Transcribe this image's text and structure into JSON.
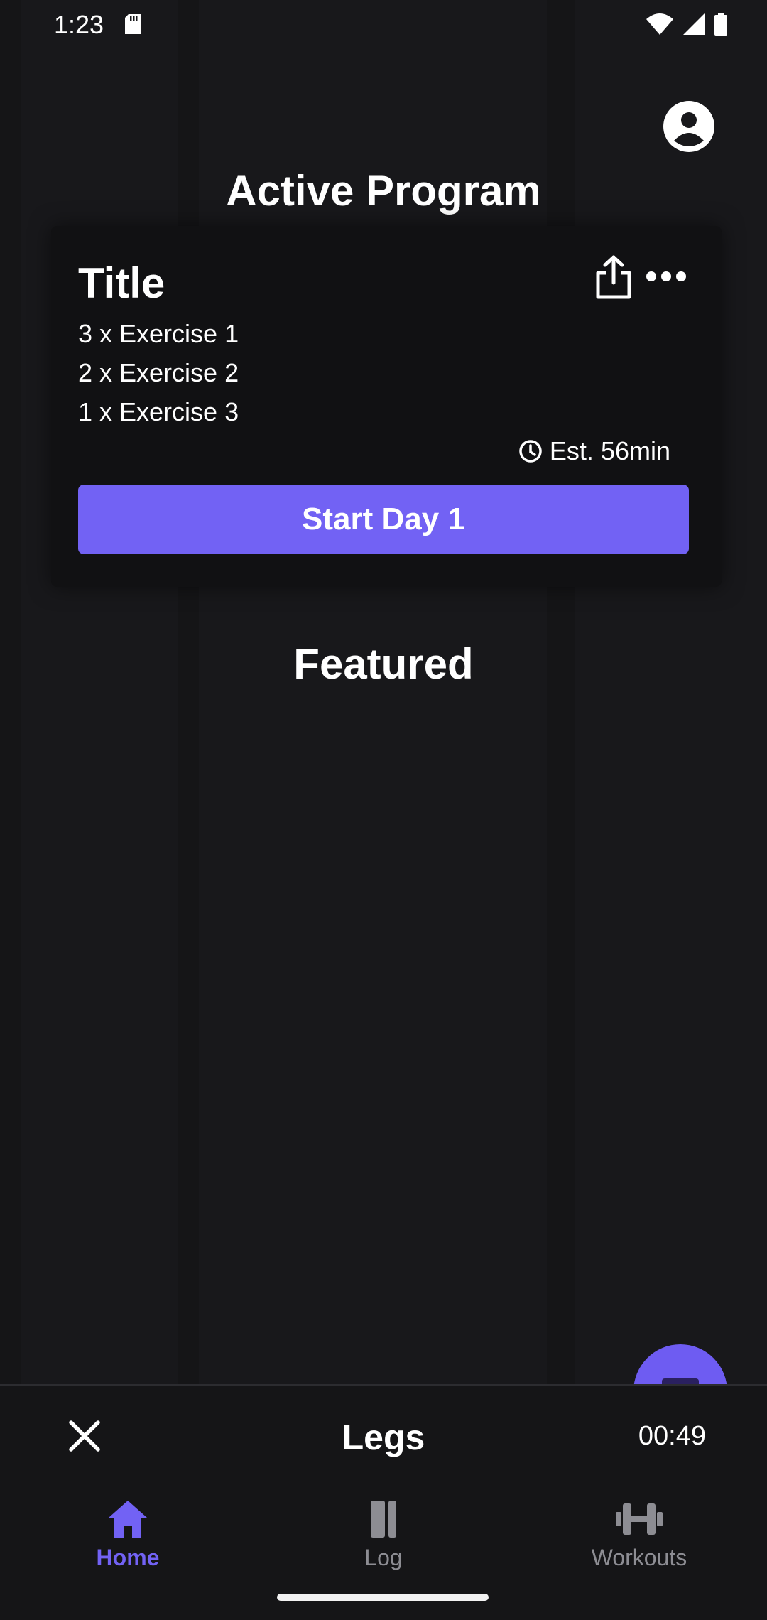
{
  "status_bar": {
    "time": "1:23"
  },
  "header": {
    "title": "Active Program"
  },
  "program_card": {
    "title": "Title",
    "exercises": [
      "3 x Exercise 1",
      "2 x Exercise 2",
      "1 x Exercise 3"
    ],
    "estimate": "Est. 56min",
    "start_label": "Start Day 1"
  },
  "featured": {
    "title": "Featured"
  },
  "workout_bar": {
    "name": "Legs",
    "timer": "00:49"
  },
  "bottom_nav": {
    "items": [
      {
        "label": "Home",
        "icon": "home-icon",
        "active": true
      },
      {
        "label": "Log",
        "icon": "log-icon",
        "active": false
      },
      {
        "label": "Workouts",
        "icon": "dumbbell-icon",
        "active": false
      }
    ]
  },
  "colors": {
    "accent": "#7262f4",
    "background": "#18181b",
    "card": "#111113",
    "inactive": "#8d8d93"
  }
}
